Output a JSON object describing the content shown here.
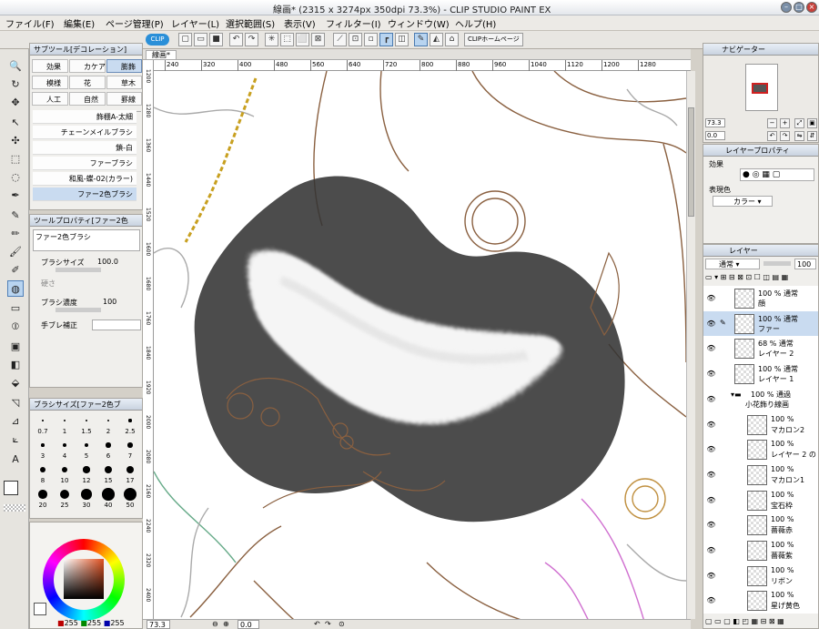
{
  "window": {
    "title": "線画* (2315 x 3274px 350dpi 73.3%) - CLIP STUDIO PAINT EX"
  },
  "menu": [
    "ファイル(F)",
    "編集(E)",
    "ページ管理(P)",
    "レイヤー(L)",
    "選択範囲(S)",
    "表示(V)",
    "フィルター(I)",
    "ウィンドウ(W)",
    "ヘルプ(H)"
  ],
  "command_bar": {
    "clip_badge": "CLIP",
    "home_label": "CLIPホームページ"
  },
  "subtool": {
    "title": "サブツール[デコレーション]",
    "groups": [
      "効果",
      "カケア",
      "膨飾",
      "模様",
      "花",
      "草木",
      "人工",
      "自然",
      "罫線"
    ],
    "brushes": [
      "飾棚A-太細",
      "チェーンメイルブラシ",
      "鎖-白",
      "ファーブラシ",
      "和風-蝶-02(カラー)",
      "ファー2色ブラシ"
    ]
  },
  "tool_property": {
    "title": "ツールプロパティ[ファー2色",
    "preset": "ファー2色ブラシ",
    "size_label": "ブラシサイズ",
    "size_value": "100.0",
    "hardness_label": "硬さ",
    "density_label": "ブラシ濃度",
    "density_value": "100",
    "stabilizer_label": "手ブレ補正"
  },
  "brush_size": {
    "title": "ブラシサイズ[ファー2色ブ",
    "sizes": [
      "0.7",
      "1",
      "1.5",
      "2",
      "2.5",
      "3",
      "4",
      "5",
      "6",
      "7",
      "8",
      "10",
      "12",
      "15",
      "17",
      "20",
      "25",
      "30",
      "40",
      "50"
    ]
  },
  "color": {
    "r": "255",
    "g": "255",
    "b": "255"
  },
  "document": {
    "tab": "線画*",
    "ruler_h": [
      "240",
      "320",
      "400",
      "480",
      "560",
      "640",
      "720",
      "800",
      "880",
      "960",
      "1040",
      "1120",
      "1200",
      "1280"
    ],
    "ruler_v": [
      "1200",
      "1280",
      "1360",
      "1440",
      "1520",
      "1600",
      "1680",
      "1760",
      "1840",
      "1920",
      "2000",
      "2080",
      "2160",
      "2240",
      "2320",
      "2400"
    ],
    "zoom": "73.3",
    "angle": "0.0"
  },
  "navigator": {
    "title": "ナビゲーター",
    "zoom": "73.3",
    "angle": "0.0"
  },
  "layer_property": {
    "title": "レイヤープロパティ",
    "effect_label": "効果",
    "color_label": "表現色",
    "color_value": "カラー"
  },
  "layers": {
    "title": "レイヤー",
    "blend": "通常",
    "opacity": "100",
    "items": [
      {
        "l1": "100 % 通常",
        "l2": "顔"
      },
      {
        "l1": "100 % 通常",
        "l2": "ファー"
      },
      {
        "l1": "68 % 通常",
        "l2": "レイヤー 2"
      },
      {
        "l1": "100 % 通常",
        "l2": "レイヤー 1"
      },
      {
        "l1": "100 % 通過",
        "l2": "小花飾り線画"
      },
      {
        "l1": "100 %",
        "l2": "マカロン2"
      },
      {
        "l1": "100 %",
        "l2": "レイヤー 2 の"
      },
      {
        "l1": "100 %",
        "l2": "マカロン1"
      },
      {
        "l1": "100 %",
        "l2": "宝石枠"
      },
      {
        "l1": "100 %",
        "l2": "薔薇赤"
      },
      {
        "l1": "100 %",
        "l2": "薔薇紫"
      },
      {
        "l1": "100 %",
        "l2": "リボン"
      },
      {
        "l1": "100 %",
        "l2": "星げ黄色"
      }
    ]
  }
}
